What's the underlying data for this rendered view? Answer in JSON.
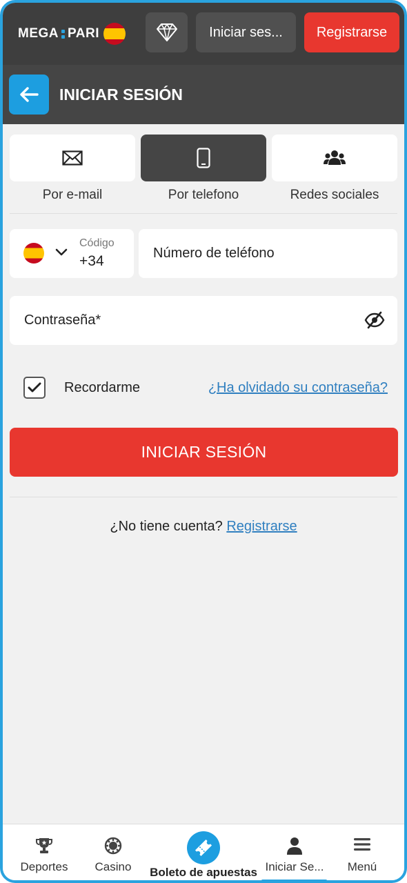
{
  "header": {
    "logo_left": "MEGA",
    "logo_right": "PARI",
    "login_label": "Iniciar ses...",
    "register_label": "Registrarse"
  },
  "title_bar": {
    "title": "INICIAR SESIÓN"
  },
  "login_methods": [
    {
      "label": "Por e-mail",
      "icon": "envelope-icon",
      "active": false
    },
    {
      "label": "Por telefono",
      "icon": "phone-icon",
      "active": true
    },
    {
      "label": "Redes sociales",
      "icon": "users-icon",
      "active": false
    }
  ],
  "phone": {
    "code_label": "Código",
    "code_value": "+34",
    "placeholder": "Número de teléfono"
  },
  "password": {
    "placeholder": "Contraseña*"
  },
  "remember": {
    "label": "Recordarme",
    "checked": true
  },
  "forgot_link": "¿Ha olvidado su contraseña?",
  "submit_label": "INICIAR SESIÓN",
  "no_account": {
    "text": "¿No tiene cuenta?",
    "link": "Registrarse"
  },
  "bottom_nav": [
    {
      "label": "Deportes",
      "icon": "trophy-icon"
    },
    {
      "label": "Casino",
      "icon": "casino-chip-icon"
    },
    {
      "label": "Boleto de apuestas",
      "icon": "ticket-icon"
    },
    {
      "label": "Iniciar Se...",
      "icon": "user-icon"
    },
    {
      "label": "Menú",
      "icon": "hamburger-icon"
    }
  ],
  "colors": {
    "accent_blue": "#1d9ee0",
    "primary_red": "#e8372f",
    "header_dark": "#3e3e3e",
    "link_blue": "#2f7fc0"
  }
}
